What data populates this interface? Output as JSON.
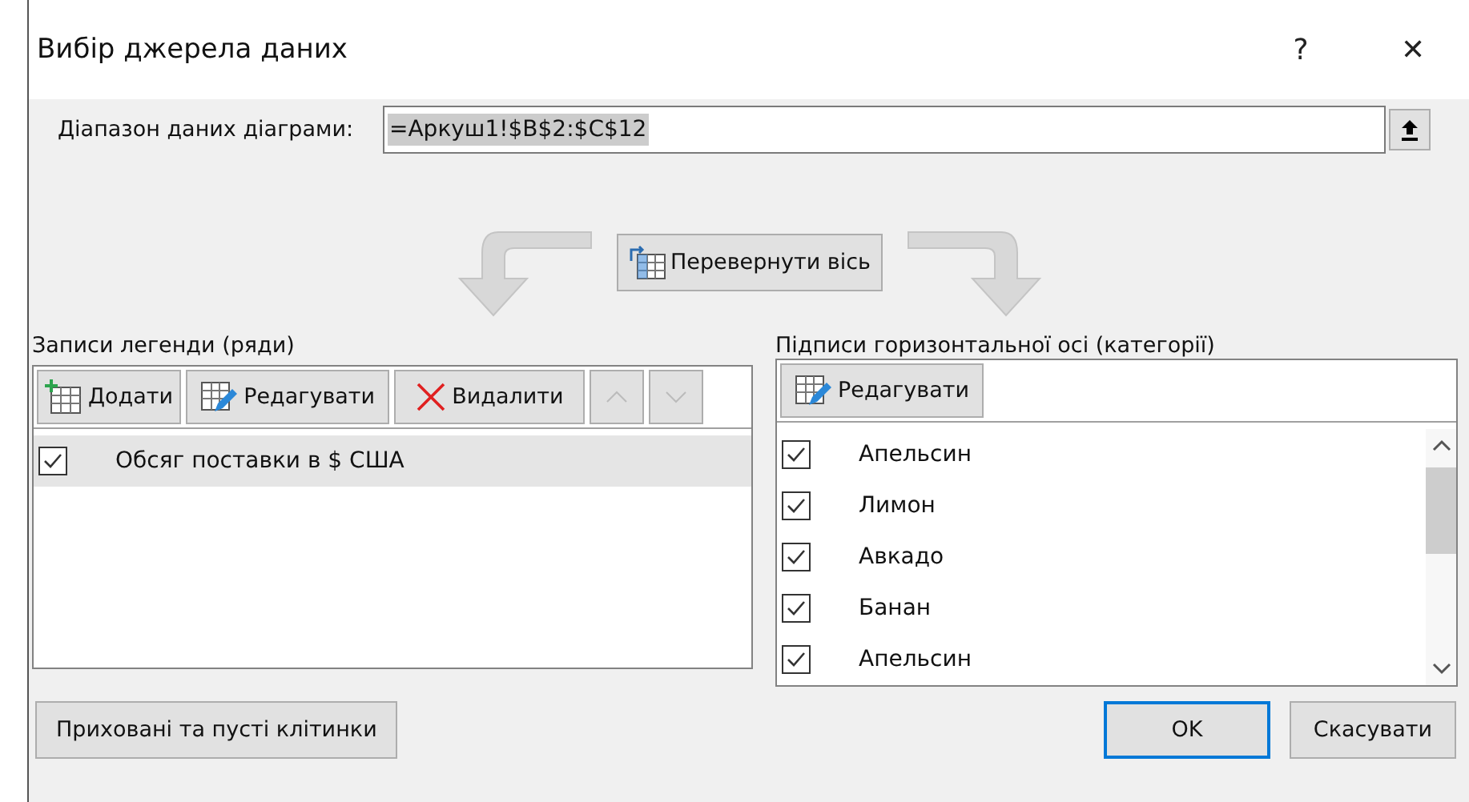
{
  "window": {
    "title": "Вибір джерела даних",
    "help": "?",
    "close": "✕"
  },
  "range": {
    "label": "Діапазон даних діаграми:",
    "value": "=Аркуш1!$B$2:$C$12"
  },
  "swap_button": "Перевернути вісь",
  "legend": {
    "title": "Записи легенди (ряди)",
    "add": "Додати",
    "edit": "Редагувати",
    "remove": "Видалити",
    "series": [
      {
        "name": "Обсяг поставки в $ США",
        "checked": true,
        "selected": true
      }
    ]
  },
  "axis": {
    "title": "Підписи горизонтальної осі (категорії)",
    "edit": "Редагувати",
    "categories": [
      {
        "name": "Апельсин",
        "checked": true
      },
      {
        "name": "Лимон",
        "checked": true
      },
      {
        "name": "Авкадо",
        "checked": true
      },
      {
        "name": "Банан",
        "checked": true
      },
      {
        "name": "Апельсин",
        "checked": true
      }
    ]
  },
  "hidden_button": "Приховані та пусті клітинки",
  "ok": "OK",
  "cancel": "Скасувати"
}
